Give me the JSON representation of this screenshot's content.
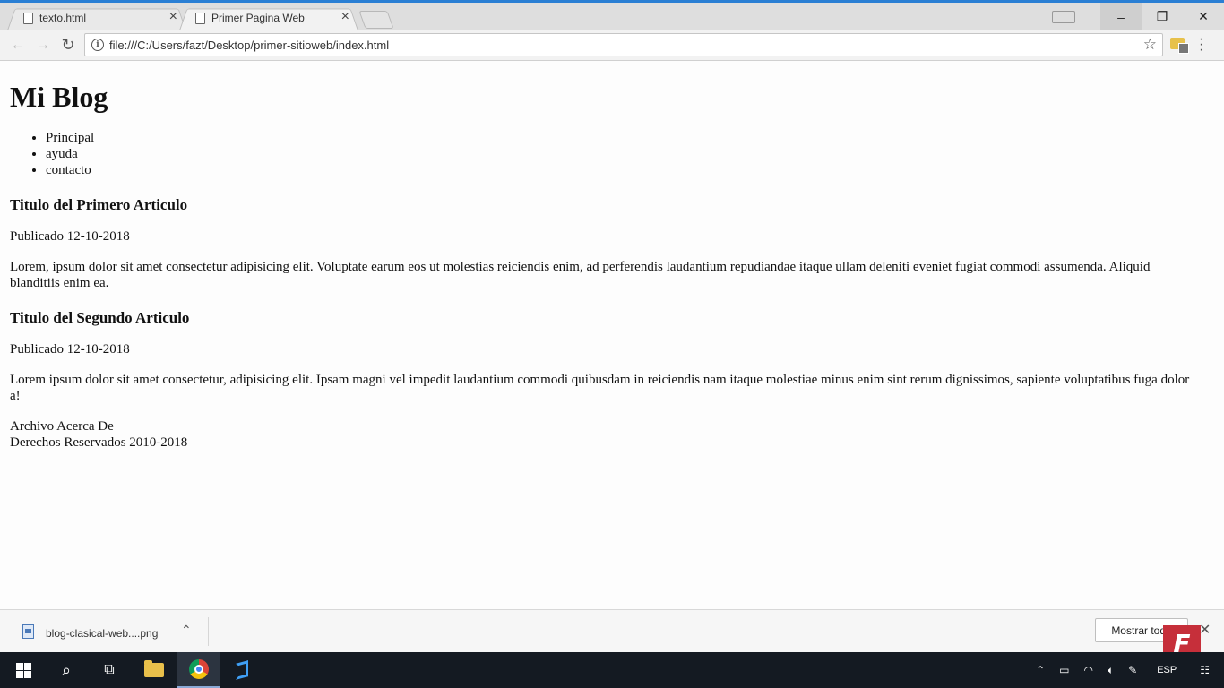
{
  "browser": {
    "tabs": [
      {
        "title": "texto.html",
        "active": false
      },
      {
        "title": "Primer Pagina Web",
        "active": true
      }
    ],
    "url": "file:///C:/Users/fazt/Desktop/primer-sitioweb/index.html"
  },
  "page": {
    "heading": "Mi Blog",
    "nav": [
      "Principal",
      "ayuda",
      "contacto"
    ],
    "articles": [
      {
        "title": "Titulo del Primero Articulo",
        "date": "Publicado 12-10-2018",
        "body": "Lorem, ipsum dolor sit amet consectetur adipisicing elit. Voluptate earum eos ut molestias reiciendis enim, ad perferendis laudantium repudiandae itaque ullam deleniti eveniet fugiat commodi assumenda. Aliquid blanditiis enim ea."
      },
      {
        "title": "Titulo del Segundo Articulo",
        "date": "Publicado 12-10-2018",
        "body": "Lorem ipsum dolor sit amet consectetur, adipisicing elit. Ipsam magni vel impedit laudantium commodi quibusdam in reiciendis nam itaque molestiae minus enim sint rerum dignissimos, sapiente voluptatibus fuga dolor a!"
      }
    ],
    "footer": {
      "links": "Archivo Acerca De",
      "copyright": "Derechos Reservados 2010-2018"
    }
  },
  "downloads": {
    "file": "blog-clasical-web....png",
    "show_all": "Mostrar todo"
  },
  "taskbar": {
    "language": "ESP"
  },
  "brand": {
    "logo_letter": "F",
    "color": "#c62f3a"
  },
  "icons": [
    "windows-start-icon",
    "search-icon",
    "task-view-icon",
    "file-explorer-icon",
    "chrome-icon",
    "vscode-icon",
    "star-icon",
    "info-icon",
    "reload-icon",
    "back-icon",
    "forward-icon",
    "more-icon",
    "close-icon"
  ]
}
